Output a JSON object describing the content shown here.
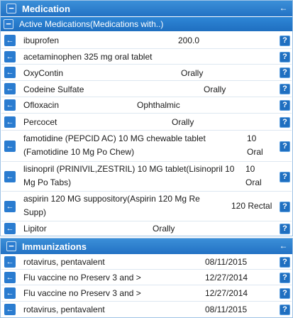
{
  "medication": {
    "title": "Medication",
    "collapse_glyph": "⇦",
    "subheader": "Active Medications(Medications with..)",
    "rows": [
      {
        "name": "ibuprofen",
        "value": "200.0"
      },
      {
        "name": "acetaminophen 325 mg oral tablet",
        "value": ""
      },
      {
        "name": "OxyContin",
        "value": "Orally"
      },
      {
        "name": "Codeine Sulfate",
        "value": "Orally"
      },
      {
        "name": "Ofloxacin",
        "value": "Ophthalmic"
      },
      {
        "name": "Percocet",
        "value": "Orally"
      },
      {
        "name1": "famotidine (PEPCID AC) 10 MG chewable tablet",
        "name2": "(Famotidine 10 Mg Po Chew)",
        "value1": "10",
        "value2": "Oral"
      },
      {
        "name1": "lisinopril (PRINIVIL,ZESTRIL) 10 MG tablet(Lisinopril 10",
        "name2": "Mg Po Tabs)",
        "value1": "10",
        "value2": "Oral"
      },
      {
        "name1": "aspirin 120 MG suppository(Aspirin 120 Mg Re",
        "name2": "Supp)",
        "value": "120 Rectal"
      },
      {
        "name": "Lipitor",
        "value": "Orally"
      }
    ]
  },
  "immunizations": {
    "title": "Immunizations",
    "rows": [
      {
        "name": "rotavirus, pentavalent",
        "date": "08/11/2015"
      },
      {
        "name": "Flu vaccine no Preserv 3 and >",
        "date": "12/27/2014"
      },
      {
        "name": "Flu vaccine no Preserv 3 and >",
        "date": "12/27/2014"
      },
      {
        "name": "rotavirus, pentavalent",
        "date": "08/11/2015"
      }
    ]
  },
  "glyphs": {
    "arrow": "←",
    "help": "?",
    "minus": "−",
    "plus": "+"
  }
}
